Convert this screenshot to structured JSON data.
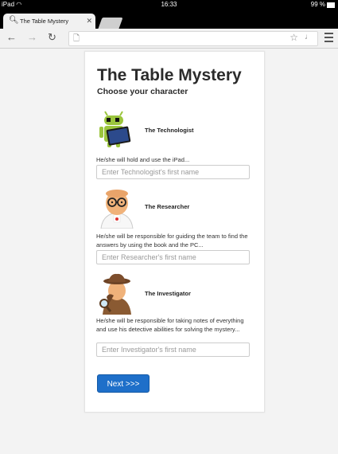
{
  "status_bar": {
    "device": "iPad",
    "time": "16:33",
    "battery": "99 %"
  },
  "browser": {
    "tab_title": "The Table Mystery"
  },
  "page": {
    "title": "The Table Mystery",
    "subtitle": "Choose your character",
    "characters": [
      {
        "name": "The Technologist",
        "description": "He/she will hold and use the iPad...",
        "placeholder": "Enter Technologist's first name",
        "value": ""
      },
      {
        "name": "The Researcher",
        "description": "He/she will be responsible for guiding the team to find the answers by using the book and the PC...",
        "placeholder": "Enter Researcher's first name",
        "value": ""
      },
      {
        "name": "The Investigator",
        "description": "He/she will be responsible for taking notes of everything and use his detective abilities for solving the mystery...",
        "placeholder": "Enter Investigator's first name",
        "value": ""
      }
    ],
    "next_label": "Next >>>"
  }
}
